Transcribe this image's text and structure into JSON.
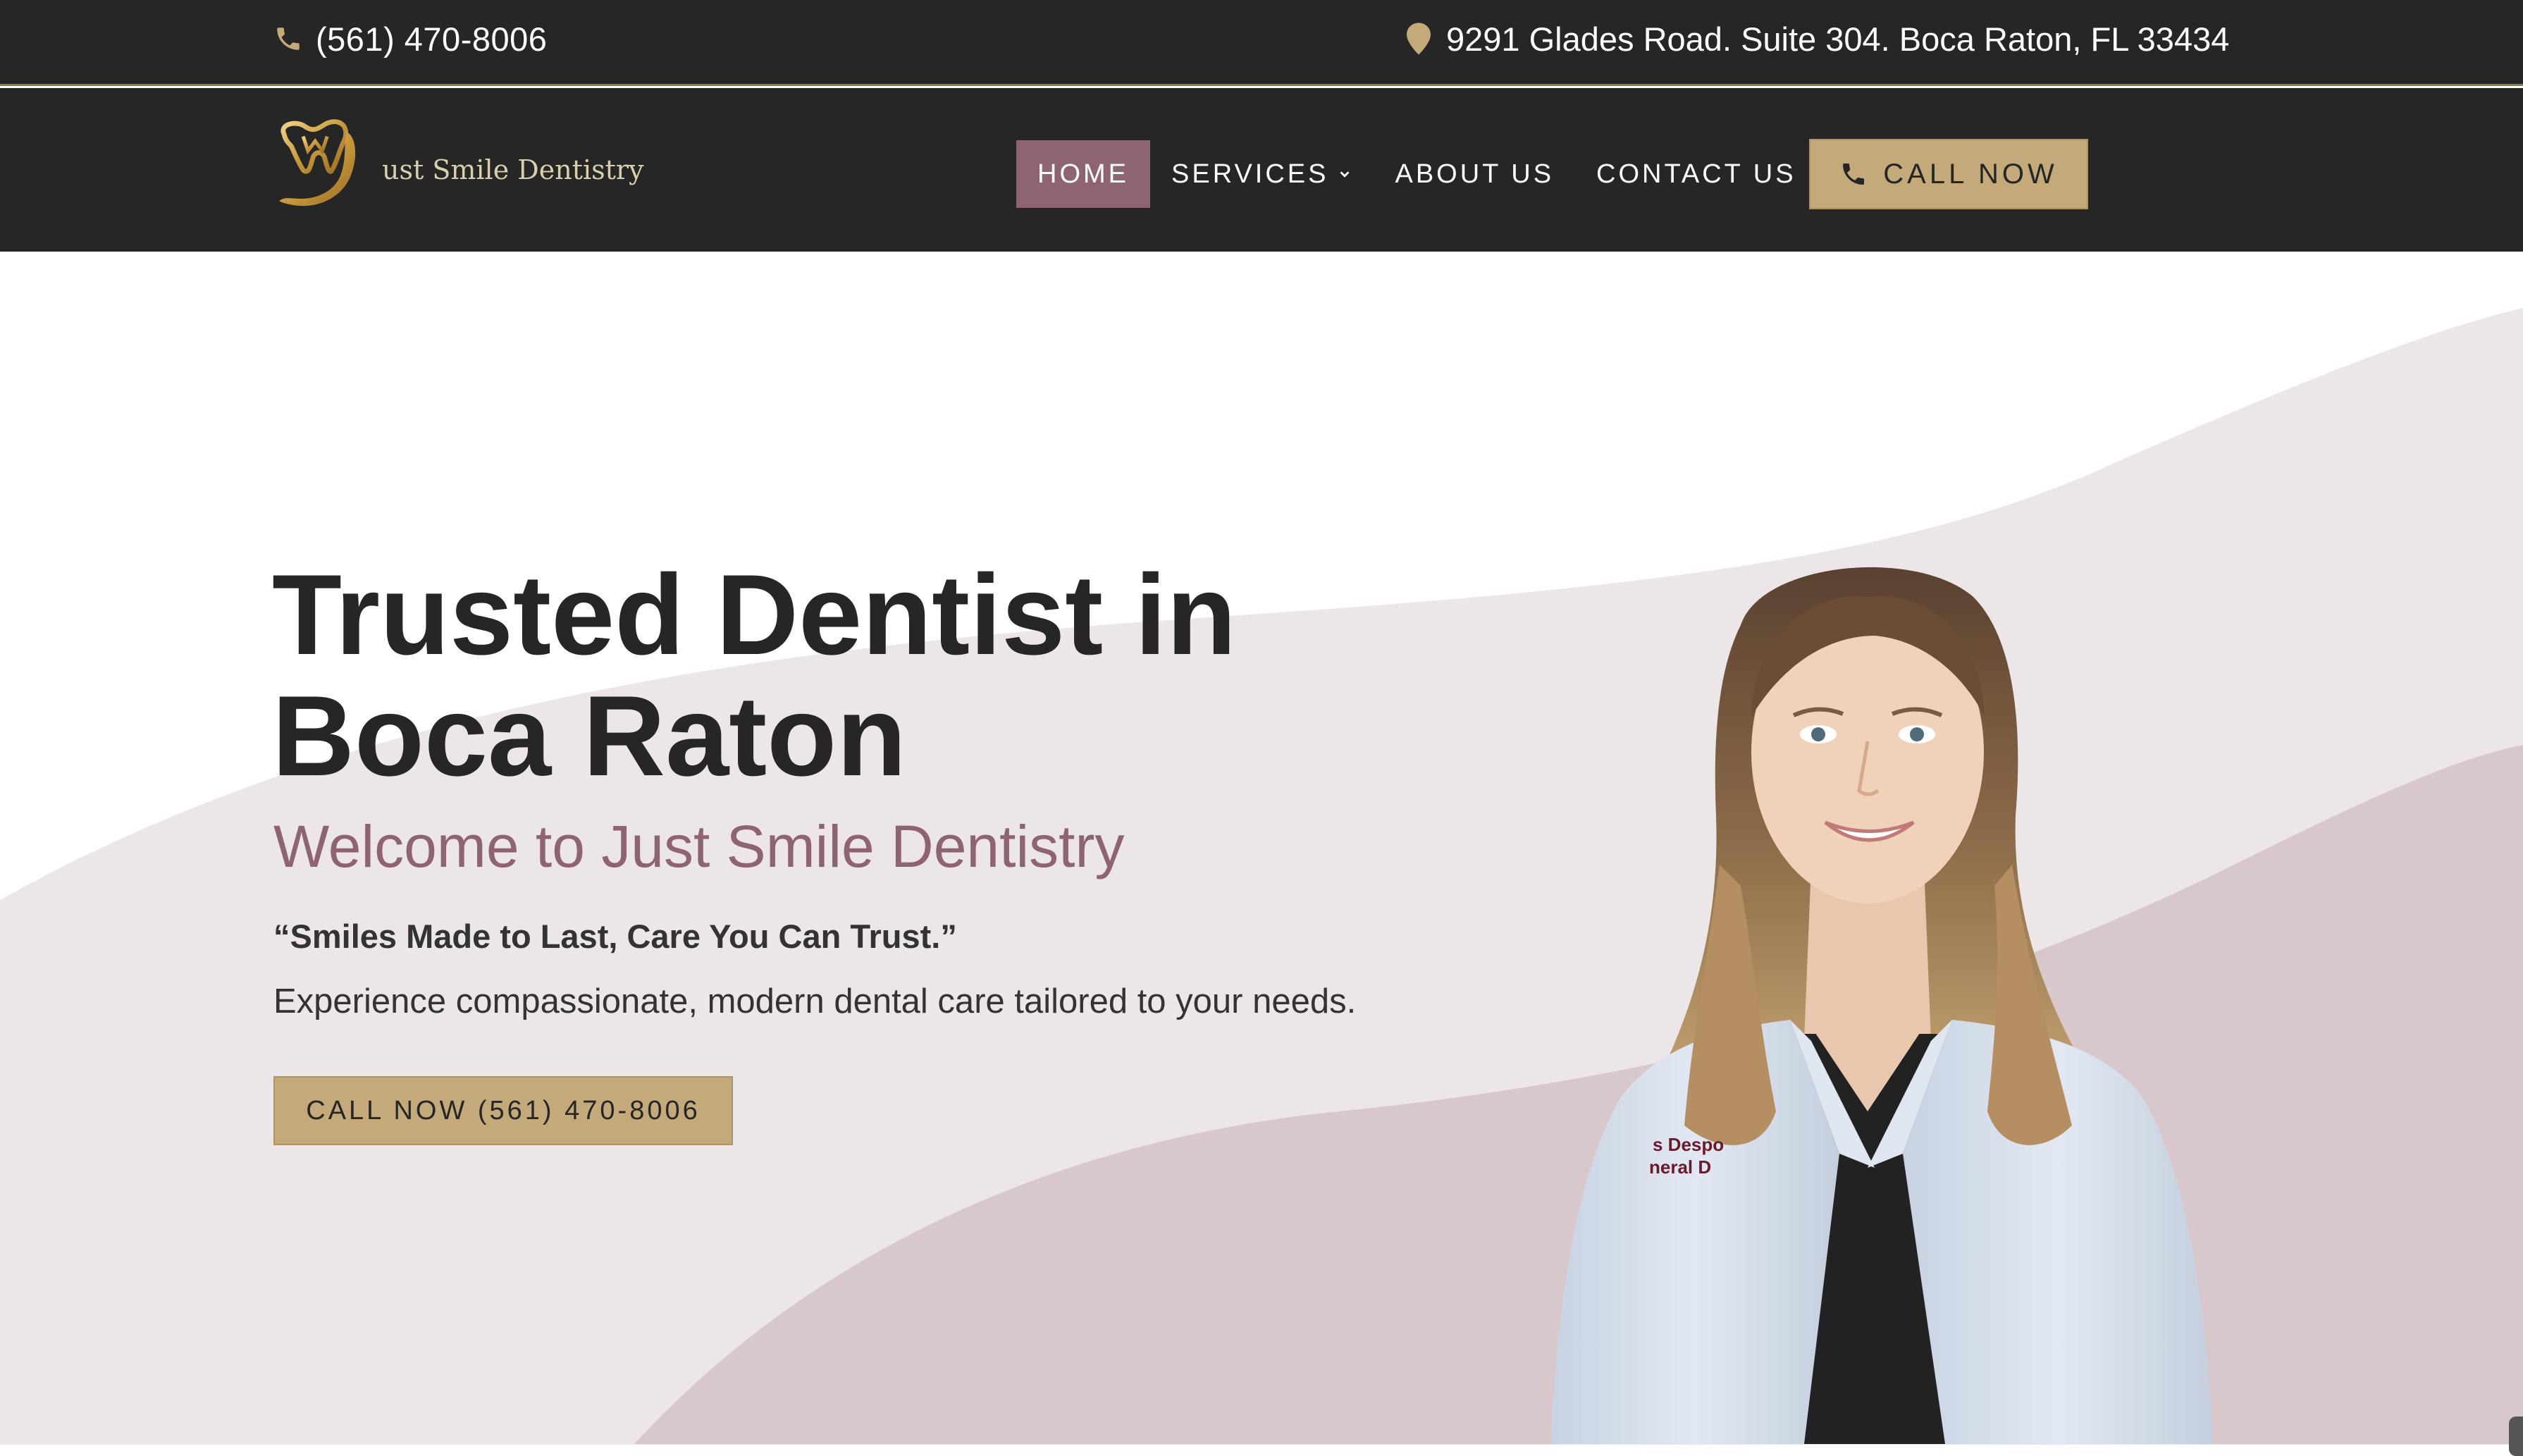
{
  "topbar": {
    "phone": "(561) 470-8006",
    "address": "9291 Glades Road. Suite 304. Boca Raton, FL 33434",
    "phone_icon": "phone-icon",
    "address_icon": "map-pin-icon"
  },
  "logo": {
    "text": "ust Smile Dentistry",
    "mark": "J"
  },
  "nav": {
    "items": [
      {
        "label": "HOME",
        "active": true
      },
      {
        "label": "SERVICES",
        "has_dropdown": true
      },
      {
        "label": "ABOUT US"
      },
      {
        "label": "CONTACT US"
      }
    ],
    "cta_label": "CALL NOW",
    "cta_icon": "phone-icon"
  },
  "hero": {
    "title_line1": "Trusted Dentist in",
    "title_line2": "Boca Raton",
    "subtitle": "Welcome to Just Smile Dentistry",
    "quote": "“Smiles Made to Last, Care You Can Trust.”",
    "description": "Experience compassionate, modern dental care tailored to your needs.",
    "cta_label": "CALL NOW (561) 470-8006",
    "badge_line1": "s Despo",
    "badge_line2": "neral D"
  },
  "colors": {
    "dark": "#262626",
    "accent_mauve": "#8e6472",
    "accent_gold": "#c4a97a",
    "wave_light": "#ede6e8",
    "wave_dark": "#d8c8cc"
  }
}
